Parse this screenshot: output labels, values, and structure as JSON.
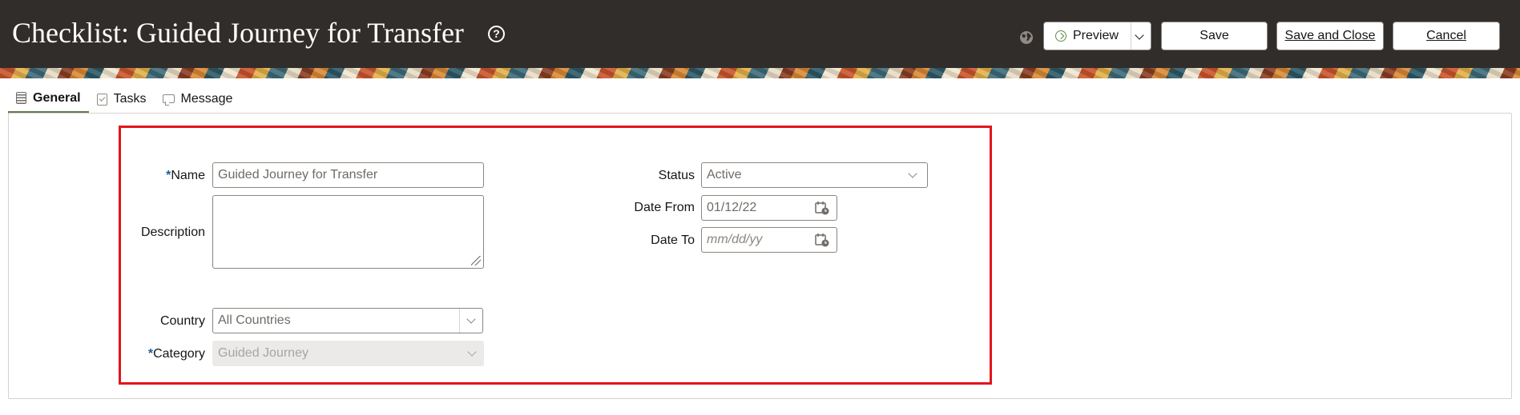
{
  "header": {
    "title": "Checklist: Guided Journey for Transfer",
    "help_icon": "question-circle-icon",
    "globe_icon": "globe-icon",
    "preview_label": "Preview",
    "save_label": "Save",
    "save_close_label": "Save and Close",
    "cancel_label": "Cancel"
  },
  "tabs": [
    {
      "label": "General",
      "icon": "form-icon",
      "active": true
    },
    {
      "label": "Tasks",
      "icon": "clipboard-check-icon",
      "active": false
    },
    {
      "label": "Message",
      "icon": "message-icon",
      "active": false
    }
  ],
  "form": {
    "name": {
      "label": "Name",
      "required": "*",
      "value": "Guided Journey for Transfer"
    },
    "description": {
      "label": "Description",
      "value": ""
    },
    "country": {
      "label": "Country",
      "value": "All Countries"
    },
    "category": {
      "label": "Category",
      "required": "*",
      "value": "Guided Journey"
    },
    "status": {
      "label": "Status",
      "value": "Active"
    },
    "date_from": {
      "label": "Date From",
      "value": "01/12/22"
    },
    "date_to": {
      "label": "Date To",
      "placeholder": "mm/dd/yy"
    }
  },
  "colors": {
    "header_bg": "#312d2a",
    "required_marker": "#1c5f99",
    "highlight_border": "#e3141c",
    "active_tab_underline": "#5f7d4f"
  }
}
